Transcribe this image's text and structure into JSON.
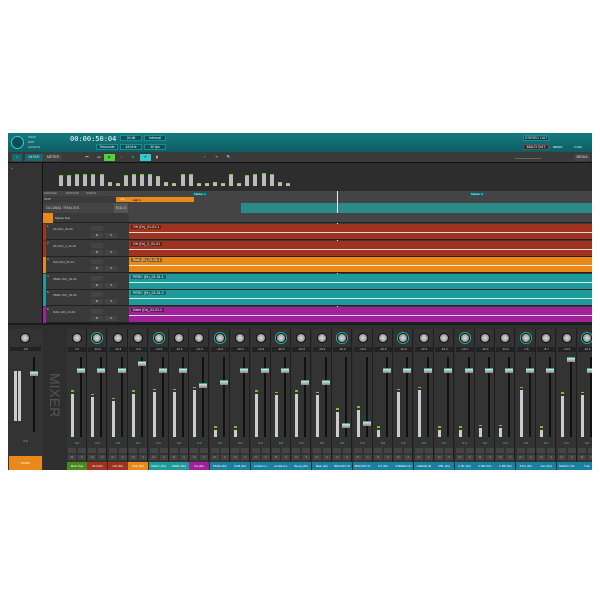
{
  "header": {
    "snap_label": "SNAP",
    "end_label": "END",
    "length_label": "LENGTH",
    "timecode": "00:00:50:04",
    "bit_depth": "24 bit",
    "clock": "Internal",
    "time_format": "Timecode",
    "sample_rate": "48 kHz",
    "frame_rate": "30 fps",
    "stereo_out": "STEREO OUT",
    "multi_out": "MULTI OUT",
    "remix": "REMIX",
    "in_mix": "In Mix"
  },
  "toolbar": {
    "mixer": "MIXER",
    "meter": "METER",
    "media": "MEDIA"
  },
  "colors": {
    "accent": "#147a80",
    "play": "#4fd23a",
    "record": "#d33",
    "red": "#9e3420",
    "orange": "#e8891a",
    "teal": "#1e9a9a",
    "magenta": "#a0229a",
    "blue": "#1a7fa0",
    "green": "#4a8a1a"
  },
  "arrange": {
    "marker": "MARKER",
    "window": "WINDOW",
    "nudge": "NUDGE",
    "skip": "SKIP",
    "on": "On",
    "global_tracks": "GLOBAL TRACKS",
    "solo": "SOLO",
    "skip_region": "skip 4",
    "marker1": "Marker 1",
    "marker2": "Marker 2",
    "master_bus": "Master Bus",
    "tracks": [
      {
        "num": "1",
        "name": "OH (Dr)_01-01",
        "clip": "OH (Dr)_01-01.1",
        "color": "#9e3420"
      },
      {
        "num": "2",
        "name": "OH (Dr)_1_01-01",
        "clip": "OH (Dr)_2_01-01",
        "color": "#9e3420"
      },
      {
        "num": "3",
        "name": "Kick (Dr)_01-01",
        "clip": "Kick (Dr)_01-01.1",
        "color": "#e8891a"
      },
      {
        "num": "4",
        "name": "PERC (Dr)_01-01",
        "clip": "PERC (Dr)_01-01.1",
        "color": "#1e9a9a"
      },
      {
        "num": "5",
        "name": "PERC (Dr)_01-01",
        "clip": "PERC (Dr)_01-01.2",
        "color": "#1e9a9a"
      },
      {
        "num": "6",
        "name": "Dxbe (Dr)_01-01",
        "clip": "Dxbe (Dr)_01-01.1",
        "color": "#a0229a"
      }
    ]
  },
  "mixer": {
    "label": "MIXER",
    "master_value": "-0.0",
    "master_readout": "0.0",
    "master_button": "PANIC",
    "strips": [
      {
        "name": "Matt Trax",
        "color": "#4a8a1a",
        "pan": "Inf",
        "fader": 0.85,
        "meter": 0.6
      },
      {
        "name": "OH (Dr)",
        "color": "#9e3420",
        "pan": "-10.3",
        "fader": 0.85,
        "meter": 0.55
      },
      {
        "name": "OH (Dr)",
        "color": "#9e3420",
        "pan": "-10.3",
        "fader": 0.85,
        "meter": 0.5
      },
      {
        "name": "Kick (Dr)",
        "color": "#e8891a",
        "pan": "-0.0",
        "fader": 0.95,
        "meter": 0.6
      },
      {
        "name": "PERC (Dr)",
        "color": "#1e9a9a",
        "pan": "-10.3",
        "fader": 0.85,
        "meter": 0.62
      },
      {
        "name": "PERC (Dr)",
        "color": "#1e9a9a",
        "pan": "-10.3",
        "fader": 0.85,
        "meter": 0.62
      },
      {
        "name": "Dx (Dr)",
        "color": "#a0229a",
        "pan": "-10.3",
        "fader": 0.65,
        "meter": 0.65
      },
      {
        "name": "PADS (Dr)",
        "color": "#1a7fa0",
        "pan": "-10.3",
        "fader": 0.7,
        "meter": 0.1
      },
      {
        "name": "SUB (Dr)",
        "color": "#1a7fa0",
        "pan": "-10.3",
        "fader": 0.85,
        "meter": 0.1
      },
      {
        "name": "Ambient L",
        "color": "#1a7fa0",
        "pan": "-10.3",
        "fader": 0.85,
        "meter": 0.6
      },
      {
        "name": "Ambient L",
        "color": "#1a7fa0",
        "pan": "-10.3",
        "fader": 0.85,
        "meter": 0.58
      },
      {
        "name": "Bump (Dr)",
        "color": "#1a7fa0",
        "pan": "-10.3",
        "fader": 0.7,
        "meter": 0.6
      },
      {
        "name": "Beat (Dr)",
        "color": "#1a7fa0",
        "pan": "-10.3",
        "fader": 0.7,
        "meter": 0.58
      },
      {
        "name": "BRCAST (P",
        "color": "#1a7fa0",
        "pan": "-10.3",
        "fader": 0.12,
        "meter": 0.35
      },
      {
        "name": "BRCAST (P",
        "color": "#1a7fa0",
        "pan": "-10.3",
        "fader": 0.15,
        "meter": 0.38
      },
      {
        "name": "FX (Dr)",
        "color": "#1a7fa0",
        "pan": "-10.3",
        "fader": 0.85,
        "meter": 0.1
      },
      {
        "name": "STEREO (D",
        "color": "#1a7fa0",
        "pan": "-10.3",
        "fader": 0.85,
        "meter": 0.62
      },
      {
        "name": "CREVE (D",
        "color": "#1a7fa0",
        "pan": "-10.3",
        "fader": 0.85,
        "meter": 0.65
      },
      {
        "name": "KBL (Dr)",
        "color": "#1a7fa0",
        "pan": "-10.3",
        "fader": 0.85,
        "meter": 0.1
      },
      {
        "name": "K BL (Dr)",
        "color": "#1a7fa0",
        "pan": "-10.7",
        "fader": 0.85,
        "meter": 0.1
      },
      {
        "name": "K BR (Dr)",
        "color": "#1a7fa0",
        "pan": "-10.3",
        "fader": 0.85,
        "meter": 0.12
      },
      {
        "name": "K BP (Dr)",
        "color": "#1a7fa0",
        "pan": "-10.3",
        "fader": 0.85,
        "meter": 0.12
      },
      {
        "name": "KTrp (Dr)",
        "color": "#1a7fa0",
        "pan": "-7.8",
        "fader": 0.85,
        "meter": 0.65
      },
      {
        "name": "Nex (Dr)",
        "color": "#1a7fa0",
        "pan": "-8.7",
        "fader": 0.85,
        "meter": 0.1
      },
      {
        "name": "SHAFLY (D",
        "color": "#1a7fa0",
        "pan": "-10.3",
        "fader": 1.0,
        "meter": 0.57
      },
      {
        "name": "Tran",
        "color": "#1a7fa0",
        "pan": "-10.3",
        "fader": 0.85,
        "meter": 0.58
      }
    ],
    "readout": "0.0",
    "mute": "M",
    "solo": "S"
  },
  "meter_levels": [
    0.55,
    0.55,
    0.6,
    0.6,
    0.6,
    0.6,
    0.2,
    0.15,
    0.55,
    0.6,
    0.6,
    0.6,
    0.5,
    0.2,
    0.15,
    0.6,
    0.6,
    0.15,
    0.15,
    0.2,
    0.15,
    0.6,
    0.15,
    0.55,
    0.6,
    0.65,
    0.6,
    0.2,
    0.15
  ]
}
